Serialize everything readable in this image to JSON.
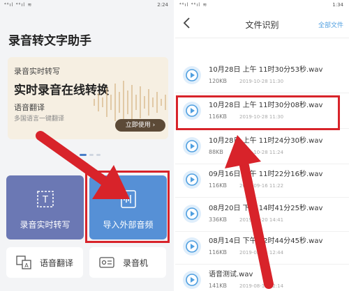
{
  "left": {
    "status": {
      "time": "2:24",
      "signal": "⁴⁶ıl ⁴⁶ıl ≋"
    },
    "app_title": "录音转文字助手",
    "banner": {
      "subtitle": "录音实时转写",
      "headline": "实时录音在线转换",
      "line3": "语音翻译",
      "line4": "多国语言一键翻译",
      "cta": "立即使用 ›"
    },
    "tiles": {
      "transcribe": "录音实时转写",
      "import": "导入外部音频",
      "translate": "语音翻译",
      "recorder": "录音机"
    }
  },
  "right": {
    "status": {
      "time": "1:34",
      "signal": "⁴⁶ıl ⁴⁶ıl ≋"
    },
    "title": "文件识别",
    "action": "全部文件",
    "files": [
      {
        "name": "10月28日 上午 11时30分53秒.wav",
        "size": "120KB",
        "date": "2019-10-28 11:30"
      },
      {
        "name": "10月28日 上午 11时30分08秒.wav",
        "size": "116KB",
        "date": "2019-10-28 11:30"
      },
      {
        "name": "10月28日 上午 11时24分30秒.wav",
        "size": "88KB",
        "date": "2019-10-28 11:24"
      },
      {
        "name": "09月16日 上午 11时22分16秒.wav",
        "size": "116KB",
        "date": "2019-09-16 11:22"
      },
      {
        "name": "08月20日 下午 14时41分25秒.wav",
        "size": "336KB",
        "date": "2019-08-20 14:41"
      },
      {
        "name": "08月14日 下午 12时44分45秒.wav",
        "size": "116KB",
        "date": "2019-08-14 12:44"
      },
      {
        "name": "语音测试.wav",
        "size": "141KB",
        "date": "2019-08-14 12:14"
      }
    ]
  },
  "colors": {
    "highlight": "#d8232a",
    "accent": "#4f9fe0",
    "tile_purple": "#6b78b4",
    "tile_blue": "#5690d6"
  },
  "icons": [
    "back-arrow-icon",
    "audio-file-icon",
    "text-box-icon",
    "audio-import-icon",
    "translate-icon",
    "recorder-icon"
  ]
}
